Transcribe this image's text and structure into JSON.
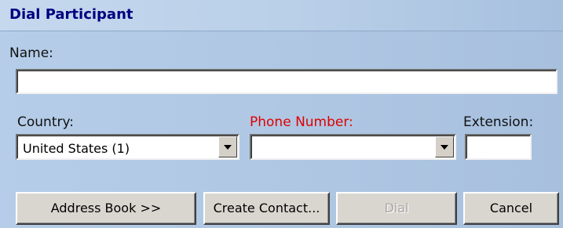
{
  "dialog": {
    "title": "Dial Participant"
  },
  "name": {
    "label": "Name:",
    "value": ""
  },
  "country": {
    "label": "Country:",
    "selected": "United States (1)"
  },
  "phone": {
    "label": "Phone Number:",
    "value": "",
    "required_color": "#e00000"
  },
  "extension": {
    "label": "Extension:",
    "value": ""
  },
  "buttons": {
    "address_book": "Address Book >>",
    "create_contact": "Create Contact...",
    "dial": "Dial",
    "cancel": "Cancel"
  },
  "icons": {
    "dropdown": "chevron-down-icon"
  },
  "colors": {
    "title_text": "#000080",
    "dialog_background": "#aec7e2",
    "button_face": "#d9d6d0"
  }
}
